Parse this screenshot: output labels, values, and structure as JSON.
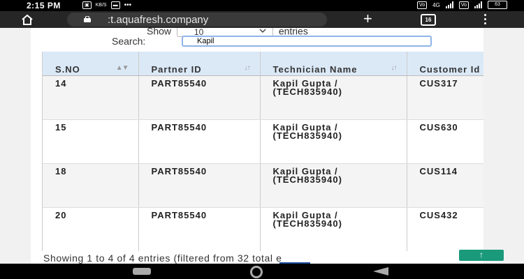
{
  "status_bar": {
    "time": "2:15 PM",
    "left_badges": [
      "฿",
      "⌁"
    ],
    "network": "4G",
    "battery": "63"
  },
  "browser": {
    "url": ":t.aquafresh.company",
    "tab_count": "16"
  },
  "controls": {
    "show_label": "Show",
    "show_value": "10",
    "entries_label": "entries",
    "search_label": "Search:",
    "search_value": "Kapil"
  },
  "table": {
    "columns": [
      {
        "label": "S.NO",
        "sort": "▲▼"
      },
      {
        "label": "Partner ID",
        "sort": "↓↑"
      },
      {
        "label": "Technician Name",
        "sort": "↓↑"
      },
      {
        "label": "Customer Id",
        "sort": ""
      }
    ],
    "rows": [
      [
        "14",
        "PART85540",
        "Kapil Gupta / (TECH835940)",
        "CUS317"
      ],
      [
        "15",
        "PART85540",
        "Kapil Gupta / (TECH835940)",
        "CUS630"
      ],
      [
        "18",
        "PART85540",
        "Kapil Gupta / (TECH835940)",
        "CUS114"
      ],
      [
        "20",
        "PART85540",
        "Kapil Gupta / (TECH835940)",
        "CUS432"
      ]
    ]
  },
  "footer": {
    "info": "Showing 1 to 4 of 4 entries (filtered from 32 total e",
    "back_to_top": "↑"
  },
  "colors": {
    "header_bg": "#dbe9f7",
    "accent": "#1a9a7a",
    "search_border": "#8fb4e8"
  }
}
